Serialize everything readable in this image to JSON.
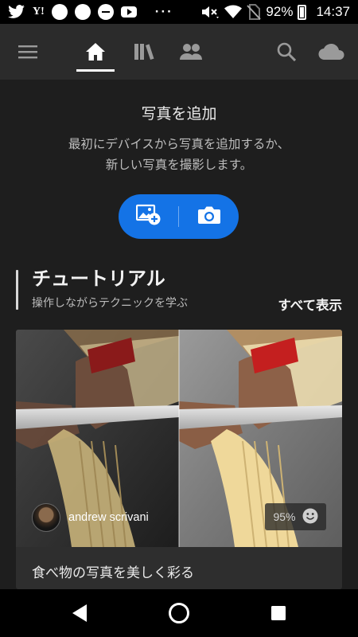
{
  "status_bar": {
    "yahoo_label": "Y!",
    "more_label": "···",
    "battery": "92%",
    "time": "14:37",
    "icons": [
      "twitter-icon",
      "yahoo-icon",
      "circle-notification-icon",
      "circle-notification-icon",
      "dnd-icon",
      "youtube-icon",
      "mute-icon",
      "wifi-icon",
      "no-sim-icon",
      "battery-icon"
    ]
  },
  "nav": {
    "items": [
      "menu-icon",
      "home-icon",
      "library-icon",
      "people-icon",
      "search-icon",
      "cloud-icon"
    ],
    "active": "home"
  },
  "add_photo": {
    "title": "写真を追加",
    "description_line1": "最初にデバイスから写真を追加するか、",
    "description_line2": "新しい写真を撮影します。",
    "accent_color": "#1473e6"
  },
  "tutorials": {
    "title": "チュートリアル",
    "subtitle": "操作しながらテクニックを学ぶ",
    "see_all": "すべて表示",
    "card": {
      "author": "andrew scrivani",
      "progress": "95%",
      "caption": "食べ物の写真を美しく彩る"
    }
  },
  "android_nav": {
    "items": [
      "back-icon",
      "home-circle-icon",
      "recents-icon"
    ]
  }
}
